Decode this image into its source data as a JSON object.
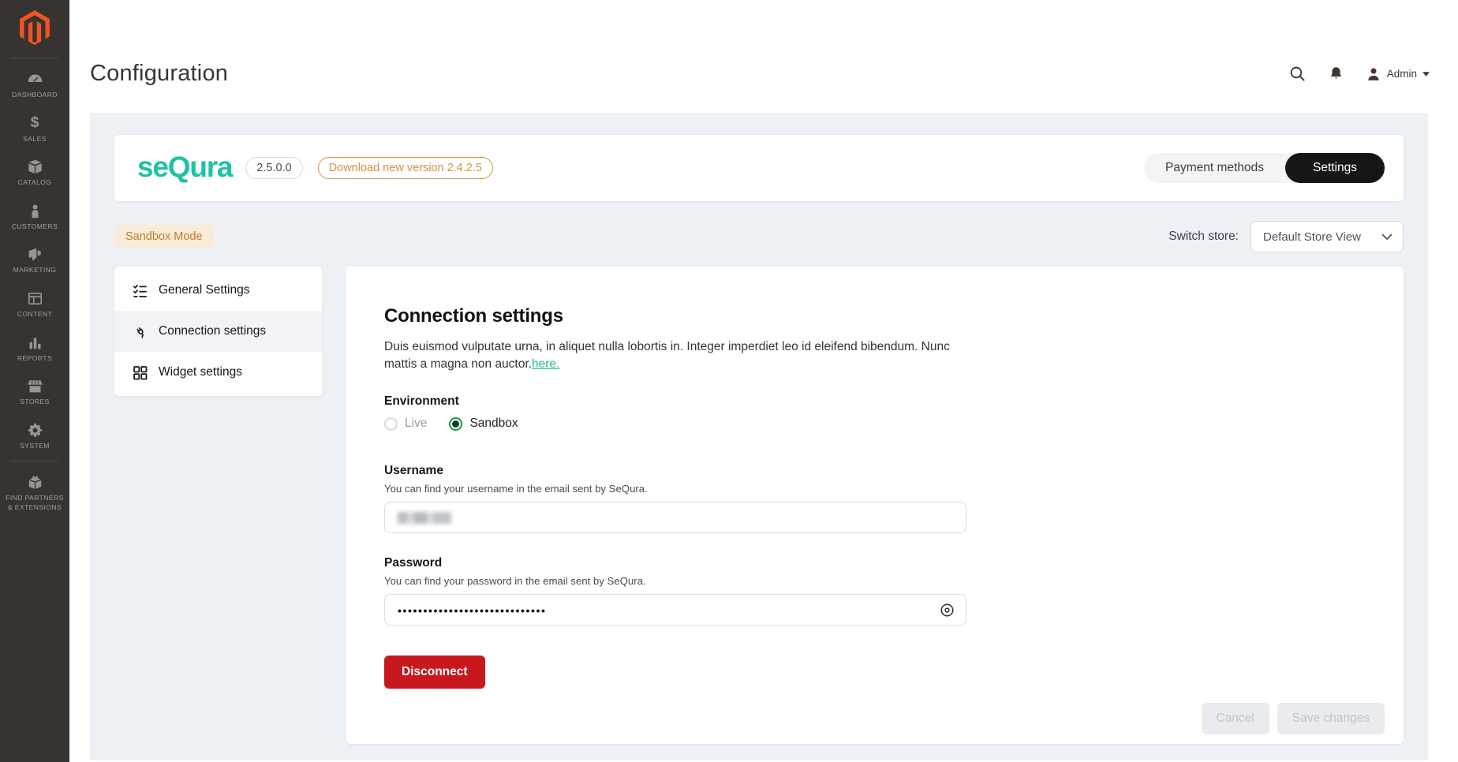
{
  "colors": {
    "brand_teal": "#1fc2a2",
    "download_orange": "#d8913d",
    "sandbox_badge_bg": "#f8ecd8",
    "sandbox_badge_text": "#bc7c30",
    "danger_red": "#c8181e",
    "radio_green": "#12984b",
    "magento_orange": "#f05423",
    "sidebar_bg": "#373330",
    "content_bg": "#edf1f6"
  },
  "sidebar": {
    "items": [
      {
        "label": "DASHBOARD",
        "icon": "dashboard-gauge-icon"
      },
      {
        "label": "SALES",
        "icon": "sales-dollar-icon"
      },
      {
        "label": "CATALOG",
        "icon": "catalog-box-icon"
      },
      {
        "label": "CUSTOMERS",
        "icon": "customers-person-icon"
      },
      {
        "label": "MARKETING",
        "icon": "marketing-megaphone-icon"
      },
      {
        "label": "CONTENT",
        "icon": "content-layout-icon"
      },
      {
        "label": "REPORTS",
        "icon": "reports-barchart-icon"
      },
      {
        "label": "STORES",
        "icon": "stores-storefront-icon"
      },
      {
        "label": "SYSTEM",
        "icon": "system-gear-icon"
      },
      {
        "label": "FIND PARTNERS & EXTENSIONS",
        "icon": "extensions-brick-icon"
      }
    ]
  },
  "header": {
    "title": "Configuration",
    "admin_label": "Admin"
  },
  "plugin_bar": {
    "brand": "seQura",
    "version": "2.5.0.0",
    "download_label": "Download new version 2.4.2.5",
    "tabs": [
      {
        "label": "Payment methods",
        "active": false
      },
      {
        "label": "Settings",
        "active": true
      }
    ]
  },
  "toolbar": {
    "sandbox_badge": "Sandbox Mode",
    "switch_store_label": "Switch store:",
    "store_select_value": "Default Store View"
  },
  "settings_nav": {
    "items": [
      {
        "label": "General Settings",
        "icon": "checklist-icon",
        "selected": false
      },
      {
        "label": "Connection settings",
        "icon": "plug-icon",
        "selected": true
      },
      {
        "label": "Widget settings",
        "icon": "widget-grid-icon",
        "selected": false
      }
    ]
  },
  "connection": {
    "heading": "Connection settings",
    "description": "Duis euismod vulputate urna, in aliquet nulla lobortis in. Integer imperdiet leo id eleifend bibendum. Nunc mattis a magna non auctor.",
    "link_label": "here.",
    "environment": {
      "label": "Environment",
      "options": [
        {
          "label": "Live",
          "selected": false
        },
        {
          "label": "Sandbox",
          "selected": true
        }
      ]
    },
    "username": {
      "label": "Username",
      "helper": "You can find your username in the email sent by SeQura.",
      "value_obscured": true
    },
    "password": {
      "label": "Password",
      "helper": "You can find your password in the email sent by SeQura.",
      "masked_value": "•••••••••••••••••••••••••••••"
    },
    "disconnect_label": "Disconnect"
  },
  "footer_actions": {
    "cancel_label": "Cancel",
    "save_label": "Save changes"
  }
}
